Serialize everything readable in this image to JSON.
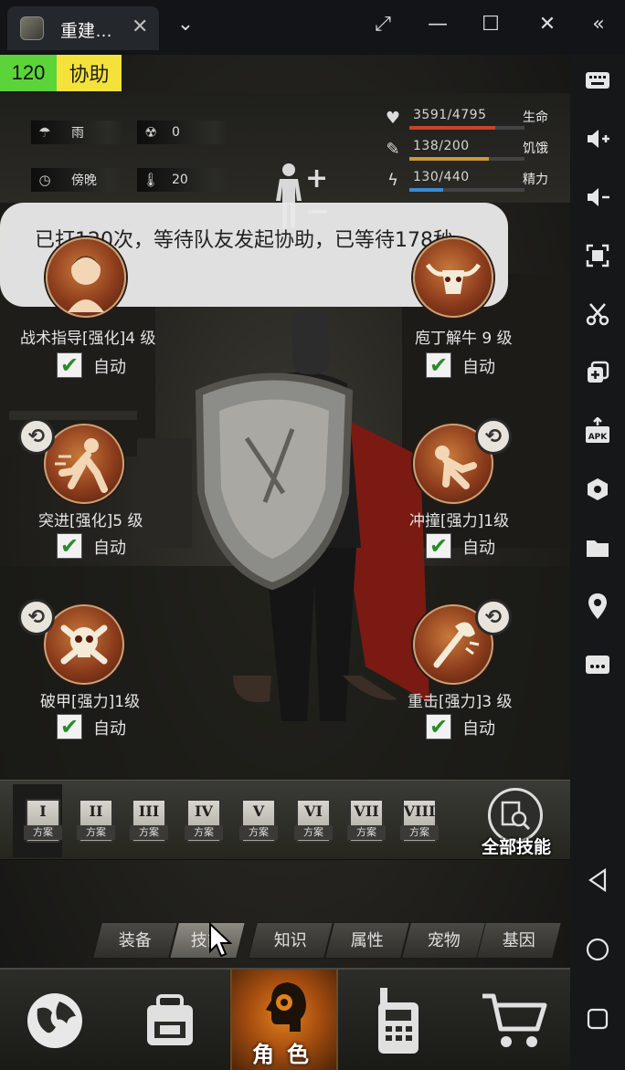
{
  "window": {
    "tab_title": "重建…",
    "tab_close": "✕",
    "tab_dropdown": "⌄",
    "buttons": {
      "screenshot": "⤢",
      "minimize": "—",
      "maximize": "☐",
      "close": "✕",
      "collapse": "«"
    }
  },
  "assist_badge": {
    "count": "120",
    "label": "协助"
  },
  "environment": {
    "weather": "雨",
    "radiation": "0",
    "time_of_day": "傍晚",
    "temperature": "20"
  },
  "vitals": [
    {
      "label": "生命",
      "value": "3591/4795",
      "ratio": 0.749,
      "color": "#c8442c",
      "icon": "heart-icon",
      "glyph": "♥"
    },
    {
      "label": "饥饿",
      "value": "138/200",
      "ratio": 0.69,
      "color": "#c99a3a",
      "icon": "stomach-icon",
      "glyph": "✎"
    },
    {
      "label": "精力",
      "value": "130/440",
      "ratio": 0.295,
      "color": "#3a8ad0",
      "icon": "energy-icon",
      "glyph": "ϟ"
    }
  ],
  "body_controls": {
    "plus": "+",
    "minus": "−"
  },
  "toast": {
    "message": "已打120次，等待队友发起协助，已等待178秒"
  },
  "skills": [
    {
      "name": "战术指导[强化]4 级",
      "auto": "自动",
      "checked": "✔",
      "icon": "tactics-icon",
      "has_swap": false
    },
    {
      "name": "庖丁解牛 9 级",
      "auto": "自动",
      "checked": "✔",
      "icon": "bull-skull-icon",
      "has_swap": false
    },
    {
      "name": "突进[强化]5 级",
      "auto": "自动",
      "checked": "✔",
      "icon": "dash-icon",
      "has_swap": true,
      "swap": "⟲"
    },
    {
      "name": "冲撞[强力]1级",
      "auto": "自动",
      "checked": "✔",
      "icon": "charge-icon",
      "has_swap": true,
      "swap": "⟲"
    },
    {
      "name": "破甲[强力]1级",
      "auto": "自动",
      "checked": "✔",
      "icon": "skull-crossbones-icon",
      "has_swap": true,
      "swap": "⟲"
    },
    {
      "name": "重击[强力]3 级",
      "auto": "自动",
      "checked": "✔",
      "icon": "heavy-strike-icon",
      "has_swap": true,
      "swap": "⟲"
    }
  ],
  "plans": [
    {
      "numeral": "I",
      "label": "方案"
    },
    {
      "numeral": "II",
      "label": "方案"
    },
    {
      "numeral": "III",
      "label": "方案"
    },
    {
      "numeral": "IV",
      "label": "方案"
    },
    {
      "numeral": "V",
      "label": "方案"
    },
    {
      "numeral": "VI",
      "label": "方案"
    },
    {
      "numeral": "VII",
      "label": "方案"
    },
    {
      "numeral": "VIII",
      "label": "方案"
    }
  ],
  "all_skills_label": "全部技能",
  "subtabs": [
    "装备",
    "技能",
    "知识",
    "属性",
    "宠物",
    "基因"
  ],
  "active_subtab": "技能",
  "bottom_nav": {
    "character_label": "角色",
    "items": [
      "world-map",
      "backpack",
      "character",
      "radio",
      "shop"
    ]
  },
  "colors": {
    "assist_green": "#5bd43a",
    "assist_yellow": "#f4e23a",
    "nav_active": "#e0821e"
  }
}
